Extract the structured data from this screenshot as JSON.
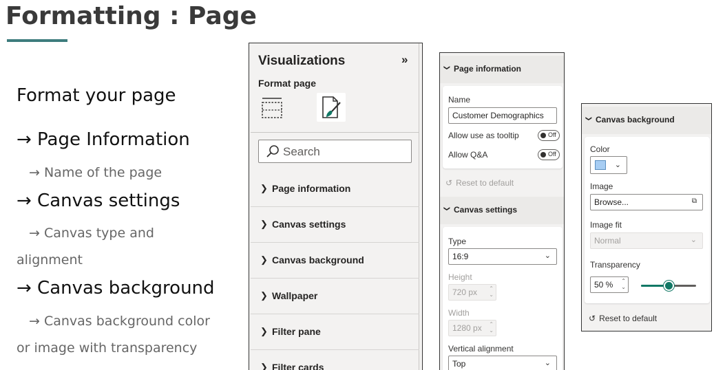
{
  "slide": {
    "title": "Formatting : Page",
    "subtitle": "Format your page",
    "bullets": [
      {
        "main": "→ Page Information",
        "sub": [
          "→ Name of the page"
        ]
      },
      {
        "main": "→ Canvas settings",
        "sub": [
          "→ Canvas type and",
          "alignment"
        ]
      },
      {
        "main": "→ Canvas background",
        "sub": [
          "→ Canvas background color",
          "or image with transparency"
        ]
      }
    ]
  },
  "visualizations": {
    "title": "Visualizations",
    "collapse_glyph": "»",
    "subtitle": "Format page",
    "search_placeholder": "Search",
    "sections": [
      "Page information",
      "Canvas settings",
      "Canvas background",
      "Wallpaper",
      "Filter pane",
      "Filter cards"
    ],
    "icons": [
      "page-layout-icon",
      "format-brush-icon",
      "search-icon",
      "chevron-right-icon"
    ]
  },
  "page_info": {
    "section_title": "Page information",
    "name_label": "Name",
    "name_value": "Customer Demographics",
    "tooltip_label": "Allow use as tooltip",
    "tooltip_state": "Off",
    "qa_label": "Allow Q&A",
    "qa_state": "Off",
    "reset_label": "Reset to default"
  },
  "canvas_settings": {
    "section_title": "Canvas settings",
    "type_label": "Type",
    "type_value": "16:9",
    "height_label": "Height",
    "height_value": "720 px",
    "width_label": "Width",
    "width_value": "1280 px",
    "valign_label": "Vertical alignment",
    "valign_value": "Top"
  },
  "canvas_background": {
    "section_title": "Canvas background",
    "color_label": "Color",
    "color_value": "#a7cdf3",
    "image_label": "Image",
    "image_value": "Browse...",
    "fit_label": "Image fit",
    "fit_value": "Normal",
    "transparency_label": "Transparency",
    "transparency_value": "50 %",
    "transparency_fraction": 0.5,
    "reset_label": "Reset to default"
  },
  "colors": {
    "accent": "#117865",
    "title_underline": "#3e7c7d"
  }
}
